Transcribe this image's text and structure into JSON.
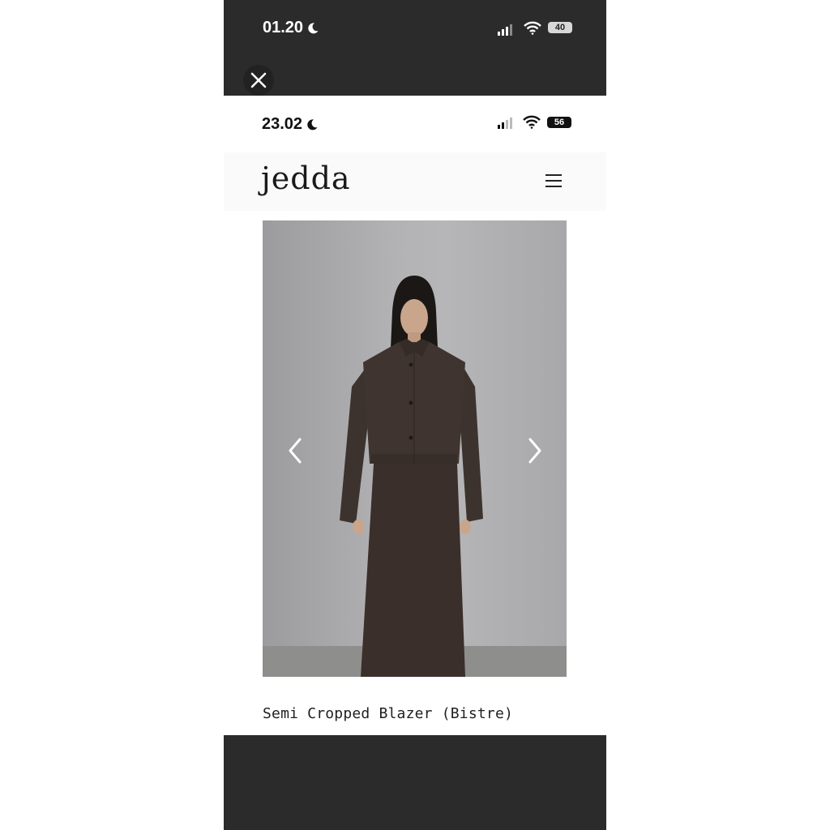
{
  "outer_status": {
    "time": "01.20",
    "battery": "40"
  },
  "inner_status": {
    "time": "23.02",
    "battery": "56"
  },
  "brand": {
    "logo": "jedda"
  },
  "product": {
    "title": "Semi Cropped Blazer (Bistre)"
  },
  "icons": [
    "moon-icon",
    "signal-icon",
    "wifi-icon",
    "battery-icon",
    "close-icon",
    "menu-icon",
    "chevron-left-icon",
    "chevron-right-icon"
  ],
  "colors": {
    "frame": "#2b2b2b",
    "page": "#ffffff",
    "garment": "#3b312c"
  }
}
